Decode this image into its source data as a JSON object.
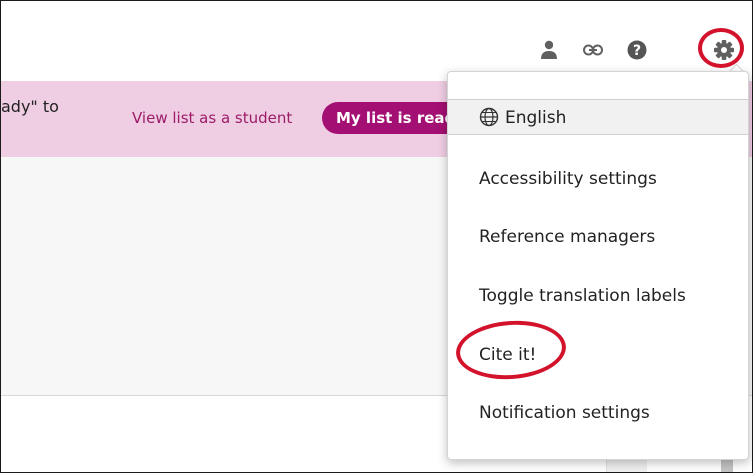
{
  "toolbar": {
    "icons": [
      "person-icon",
      "link-icon",
      "help-icon",
      "gear-icon"
    ]
  },
  "banner": {
    "text_fragment": "ady\" to",
    "view_student_link": "View list as a student",
    "ready_button": "My list is read"
  },
  "menu": {
    "language": "English",
    "items": [
      "Accessibility settings",
      "Reference managers",
      "Toggle translation labels",
      "Cite it!",
      "Notification settings"
    ]
  },
  "colors": {
    "banner_bg": "#efcde3",
    "accent": "#a30f72",
    "annotation_red": "#d3132c"
  }
}
